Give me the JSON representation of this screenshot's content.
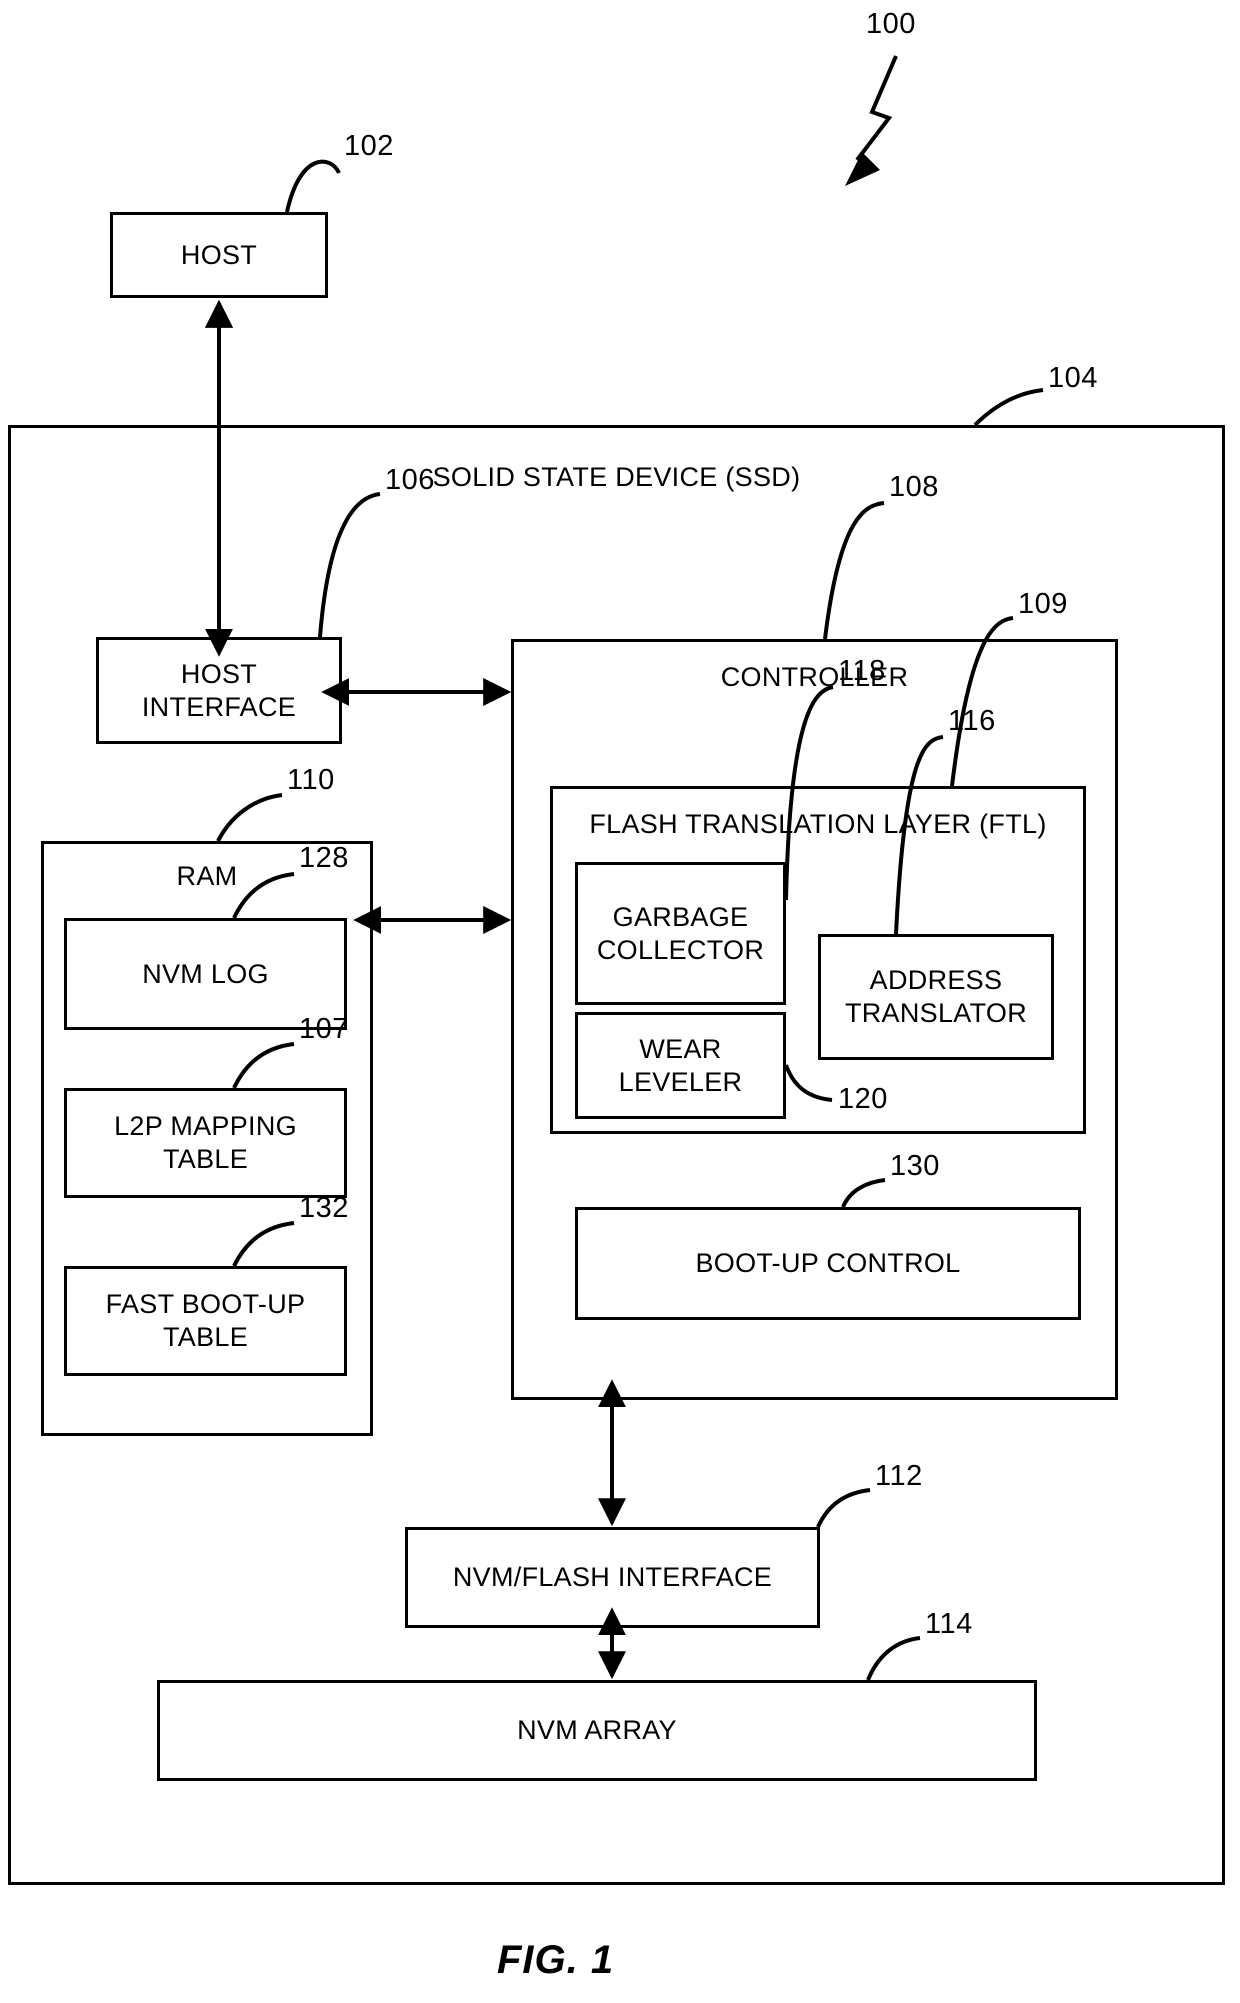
{
  "figure": {
    "caption": "FIG. 1",
    "root_ref": "100"
  },
  "nodes": {
    "host": {
      "label": "HOST",
      "ref": "102"
    },
    "ssd": {
      "label": "SOLID STATE DEVICE (SSD)",
      "ref": "104"
    },
    "host_interface": {
      "label": "HOST\nINTERFACE",
      "ref": "106"
    },
    "controller": {
      "label": "CONTROLLER",
      "ref": "108"
    },
    "ftl": {
      "label": "FLASH TRANSLATION LAYER (FTL)",
      "ref": "109"
    },
    "garbage_collector": {
      "label": "GARBAGE\nCOLLECTOR",
      "ref": "118"
    },
    "wear_leveler": {
      "label": "WEAR\nLEVELER",
      "ref": "120"
    },
    "address_translator": {
      "label": "ADDRESS\nTRANSLATOR",
      "ref": "116"
    },
    "boot_up_control": {
      "label": "BOOT-UP CONTROL",
      "ref": "130"
    },
    "ram": {
      "label": "RAM",
      "ref": "110"
    },
    "nvm_log": {
      "label": "NVM LOG",
      "ref": "128"
    },
    "l2p_mapping_table": {
      "label": "L2P MAPPING\nTABLE",
      "ref": "107"
    },
    "fast_boot_up_table": {
      "label": "FAST BOOT-UP\nTABLE",
      "ref": "132"
    },
    "nvm_flash_interface": {
      "label": "NVM/FLASH INTERFACE",
      "ref": "112"
    },
    "nvm_array": {
      "label": "NVM ARRAY",
      "ref": "114"
    }
  },
  "connections": [
    {
      "name": "host-to-host-interface",
      "from": "host",
      "to": "host_interface",
      "style": "double-arrow-vertical"
    },
    {
      "name": "host-interface-to-controller",
      "from": "host_interface",
      "to": "controller",
      "style": "double-arrow-horizontal"
    },
    {
      "name": "ram-to-controller",
      "from": "ram",
      "to": "controller",
      "style": "double-arrow-horizontal"
    },
    {
      "name": "controller-to-nvm-flash-interface",
      "from": "controller",
      "to": "nvm_flash_interface",
      "style": "double-arrow-vertical"
    },
    {
      "name": "nvm-flash-interface-to-nvm-array",
      "from": "nvm_flash_interface",
      "to": "nvm_array",
      "style": "double-arrow-vertical"
    }
  ],
  "colors": {
    "stroke": "#000000",
    "background": "#ffffff"
  }
}
